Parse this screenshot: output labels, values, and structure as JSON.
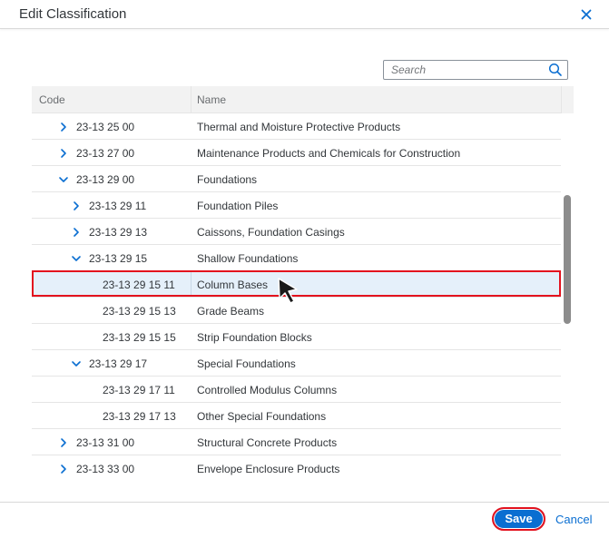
{
  "dialog": {
    "title": "Edit Classification",
    "close_icon": "close-icon"
  },
  "search": {
    "placeholder": "Search",
    "value": "",
    "icon": "search-icon"
  },
  "table": {
    "columns": [
      "Code",
      "Name"
    ],
    "rows": [
      {
        "code": "23-13 25 00",
        "name": "Thermal and Moisture Protective Products",
        "level": 0,
        "expander": "collapsed",
        "selected": false
      },
      {
        "code": "23-13 27 00",
        "name": "Maintenance Products and Chemicals for Construction",
        "level": 0,
        "expander": "collapsed",
        "selected": false
      },
      {
        "code": "23-13 29 00",
        "name": "Foundations",
        "level": 0,
        "expander": "expanded",
        "selected": false
      },
      {
        "code": "23-13 29 11",
        "name": "Foundation Piles",
        "level": 1,
        "expander": "collapsed",
        "selected": false
      },
      {
        "code": "23-13 29 13",
        "name": "Caissons, Foundation Casings",
        "level": 1,
        "expander": "collapsed",
        "selected": false
      },
      {
        "code": "23-13 29 15",
        "name": "Shallow Foundations",
        "level": 1,
        "expander": "expanded",
        "selected": false
      },
      {
        "code": "23-13 29 15 11",
        "name": "Column Bases",
        "level": 2,
        "expander": "none",
        "selected": true
      },
      {
        "code": "23-13 29 15 13",
        "name": "Grade Beams",
        "level": 2,
        "expander": "none",
        "selected": false
      },
      {
        "code": "23-13 29 15 15",
        "name": "Strip Foundation Blocks",
        "level": 2,
        "expander": "none",
        "selected": false
      },
      {
        "code": "23-13 29 17",
        "name": "Special Foundations",
        "level": 1,
        "expander": "expanded",
        "selected": false
      },
      {
        "code": "23-13 29 17 11",
        "name": "Controlled Modulus Columns",
        "level": 2,
        "expander": "none",
        "selected": false
      },
      {
        "code": "23-13 29 17 13",
        "name": "Other Special Foundations",
        "level": 2,
        "expander": "none",
        "selected": false
      },
      {
        "code": "23-13 31 00",
        "name": "Structural Concrete Products",
        "level": 0,
        "expander": "collapsed",
        "selected": false
      },
      {
        "code": "23-13 33 00",
        "name": "Envelope Enclosure Products",
        "level": 0,
        "expander": "collapsed",
        "selected": false
      }
    ]
  },
  "footer": {
    "save_label": "Save",
    "cancel_label": "Cancel"
  },
  "colors": {
    "accent": "#0a6ed1",
    "selection": "#e5f0fa",
    "highlight_box": "#e3121e",
    "text": "#32363a"
  }
}
